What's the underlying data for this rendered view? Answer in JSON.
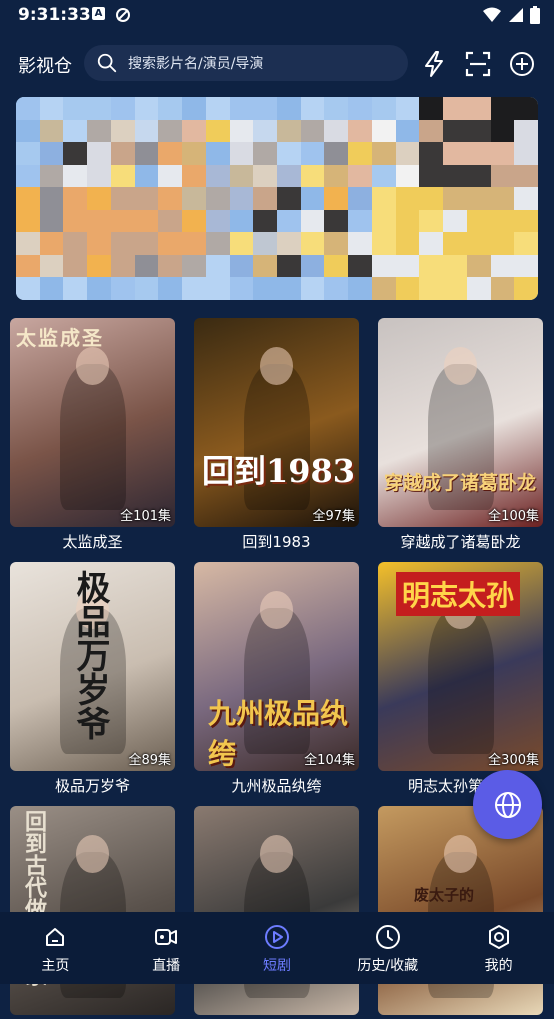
{
  "status": {
    "time": "9:31:33",
    "notif_letter": "A"
  },
  "header": {
    "title": "影视仓",
    "search_placeholder": "搜索影片名/演员/导演"
  },
  "videos": [
    {
      "title": "太监成圣",
      "episodes": "全101集",
      "poster_text": "太监成圣",
      "colors": [
        "#c8a7a0",
        "#7a5448",
        "#2d2632"
      ]
    },
    {
      "title": "回到1983",
      "episodes": "全97集",
      "poster_text": "回到1983",
      "colors": [
        "#3a2a12",
        "#8a5a1e",
        "#1b120a"
      ]
    },
    {
      "title": "穿越成了诸葛卧龙",
      "episodes": "全100集",
      "poster_text": "穿越成了诸葛卧龙",
      "colors": [
        "#c8c2c0",
        "#e8e0dc",
        "#6b2020"
      ]
    },
    {
      "title": "极品万岁爷",
      "episodes": "全89集",
      "poster_text": "极品万岁爷",
      "colors": [
        "#e9e3dc",
        "#c9bdb0",
        "#6b5f52"
      ]
    },
    {
      "title": "九州极品纨绔",
      "episodes": "全104集",
      "poster_text": "九州极品纨绔",
      "colors": [
        "#d7b9a4",
        "#7b6a80",
        "#3b2a28"
      ]
    },
    {
      "title": "明志太孙第一季",
      "episodes": "全300集",
      "poster_text": "明志太孙",
      "colors": [
        "#f4c02a",
        "#3a3a5a",
        "#7a4a2a"
      ]
    },
    {
      "title": "",
      "episodes": "",
      "poster_text": "回到古代做极品家",
      "colors": [
        "#9a8f86",
        "#5a524c",
        "#2a2624"
      ]
    },
    {
      "title": "",
      "episodes": "",
      "poster_text": "",
      "colors": [
        "#8a7a70",
        "#3a3a3a",
        "#c9b8a8"
      ]
    },
    {
      "title": "",
      "episodes": "",
      "poster_text": "废太子的",
      "colors": [
        "#c49a60",
        "#7a4a2a",
        "#e8d8b8"
      ]
    }
  ],
  "nav": [
    {
      "label": "主页",
      "icon": "home-icon",
      "active": false
    },
    {
      "label": "直播",
      "icon": "live-tv-icon",
      "active": false
    },
    {
      "label": "短剧",
      "icon": "play-circle-icon",
      "active": true
    },
    {
      "label": "历史/收藏",
      "icon": "clock-icon",
      "active": false
    },
    {
      "label": "我的",
      "icon": "settings-icon",
      "active": false
    }
  ],
  "theme": {
    "background": "#0e2243",
    "nav_active": "#6d7cff",
    "fab": "#5b5ce6"
  }
}
